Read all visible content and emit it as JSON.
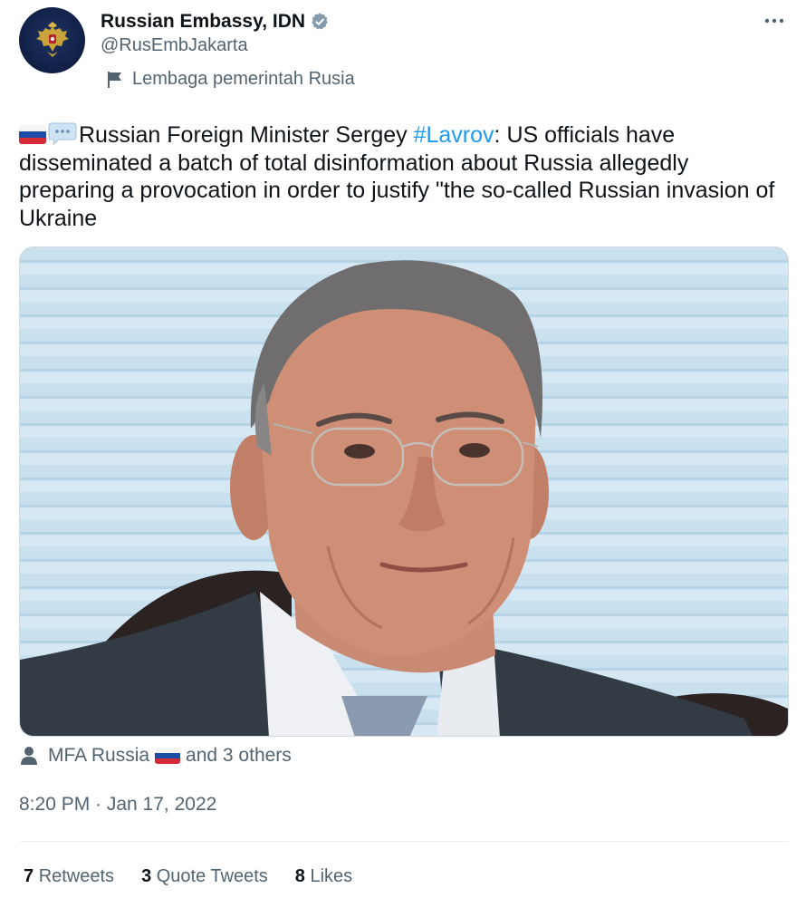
{
  "author": {
    "display_name": "Russian Embassy, IDN",
    "handle": "@RusEmbJakarta",
    "affiliation": "Lembaga pemerintah Rusia"
  },
  "tweet": {
    "text_before_hashtag": "Russian Foreign Minister Sergey ",
    "hashtag": "#Lavrov",
    "text_after_hashtag": ": US officials have disseminated a batch of total disinformation about Russia allegedly preparing a provocation in order to justify \"the so-called Russian invasion of Ukraine"
  },
  "tagged": {
    "first": "MFA Russia",
    "rest": "and 3 others"
  },
  "timestamp": "8:20 PM · Jan 17, 2022",
  "stats": {
    "retweets_count": "7",
    "retweets_label": "Retweets",
    "quotes_count": "3",
    "quotes_label": "Quote Tweets",
    "likes_count": "8",
    "likes_label": "Likes"
  },
  "colors": {
    "link_blue": "#1d9bf0",
    "secondary_text": "#536471",
    "primary_text": "#0f1419"
  },
  "icons": [
    "verified-badge-icon",
    "more-options-icon",
    "affiliation-flag-icon",
    "russia-flag-icon",
    "speech-bubble-icon",
    "tagged-person-icon"
  ]
}
